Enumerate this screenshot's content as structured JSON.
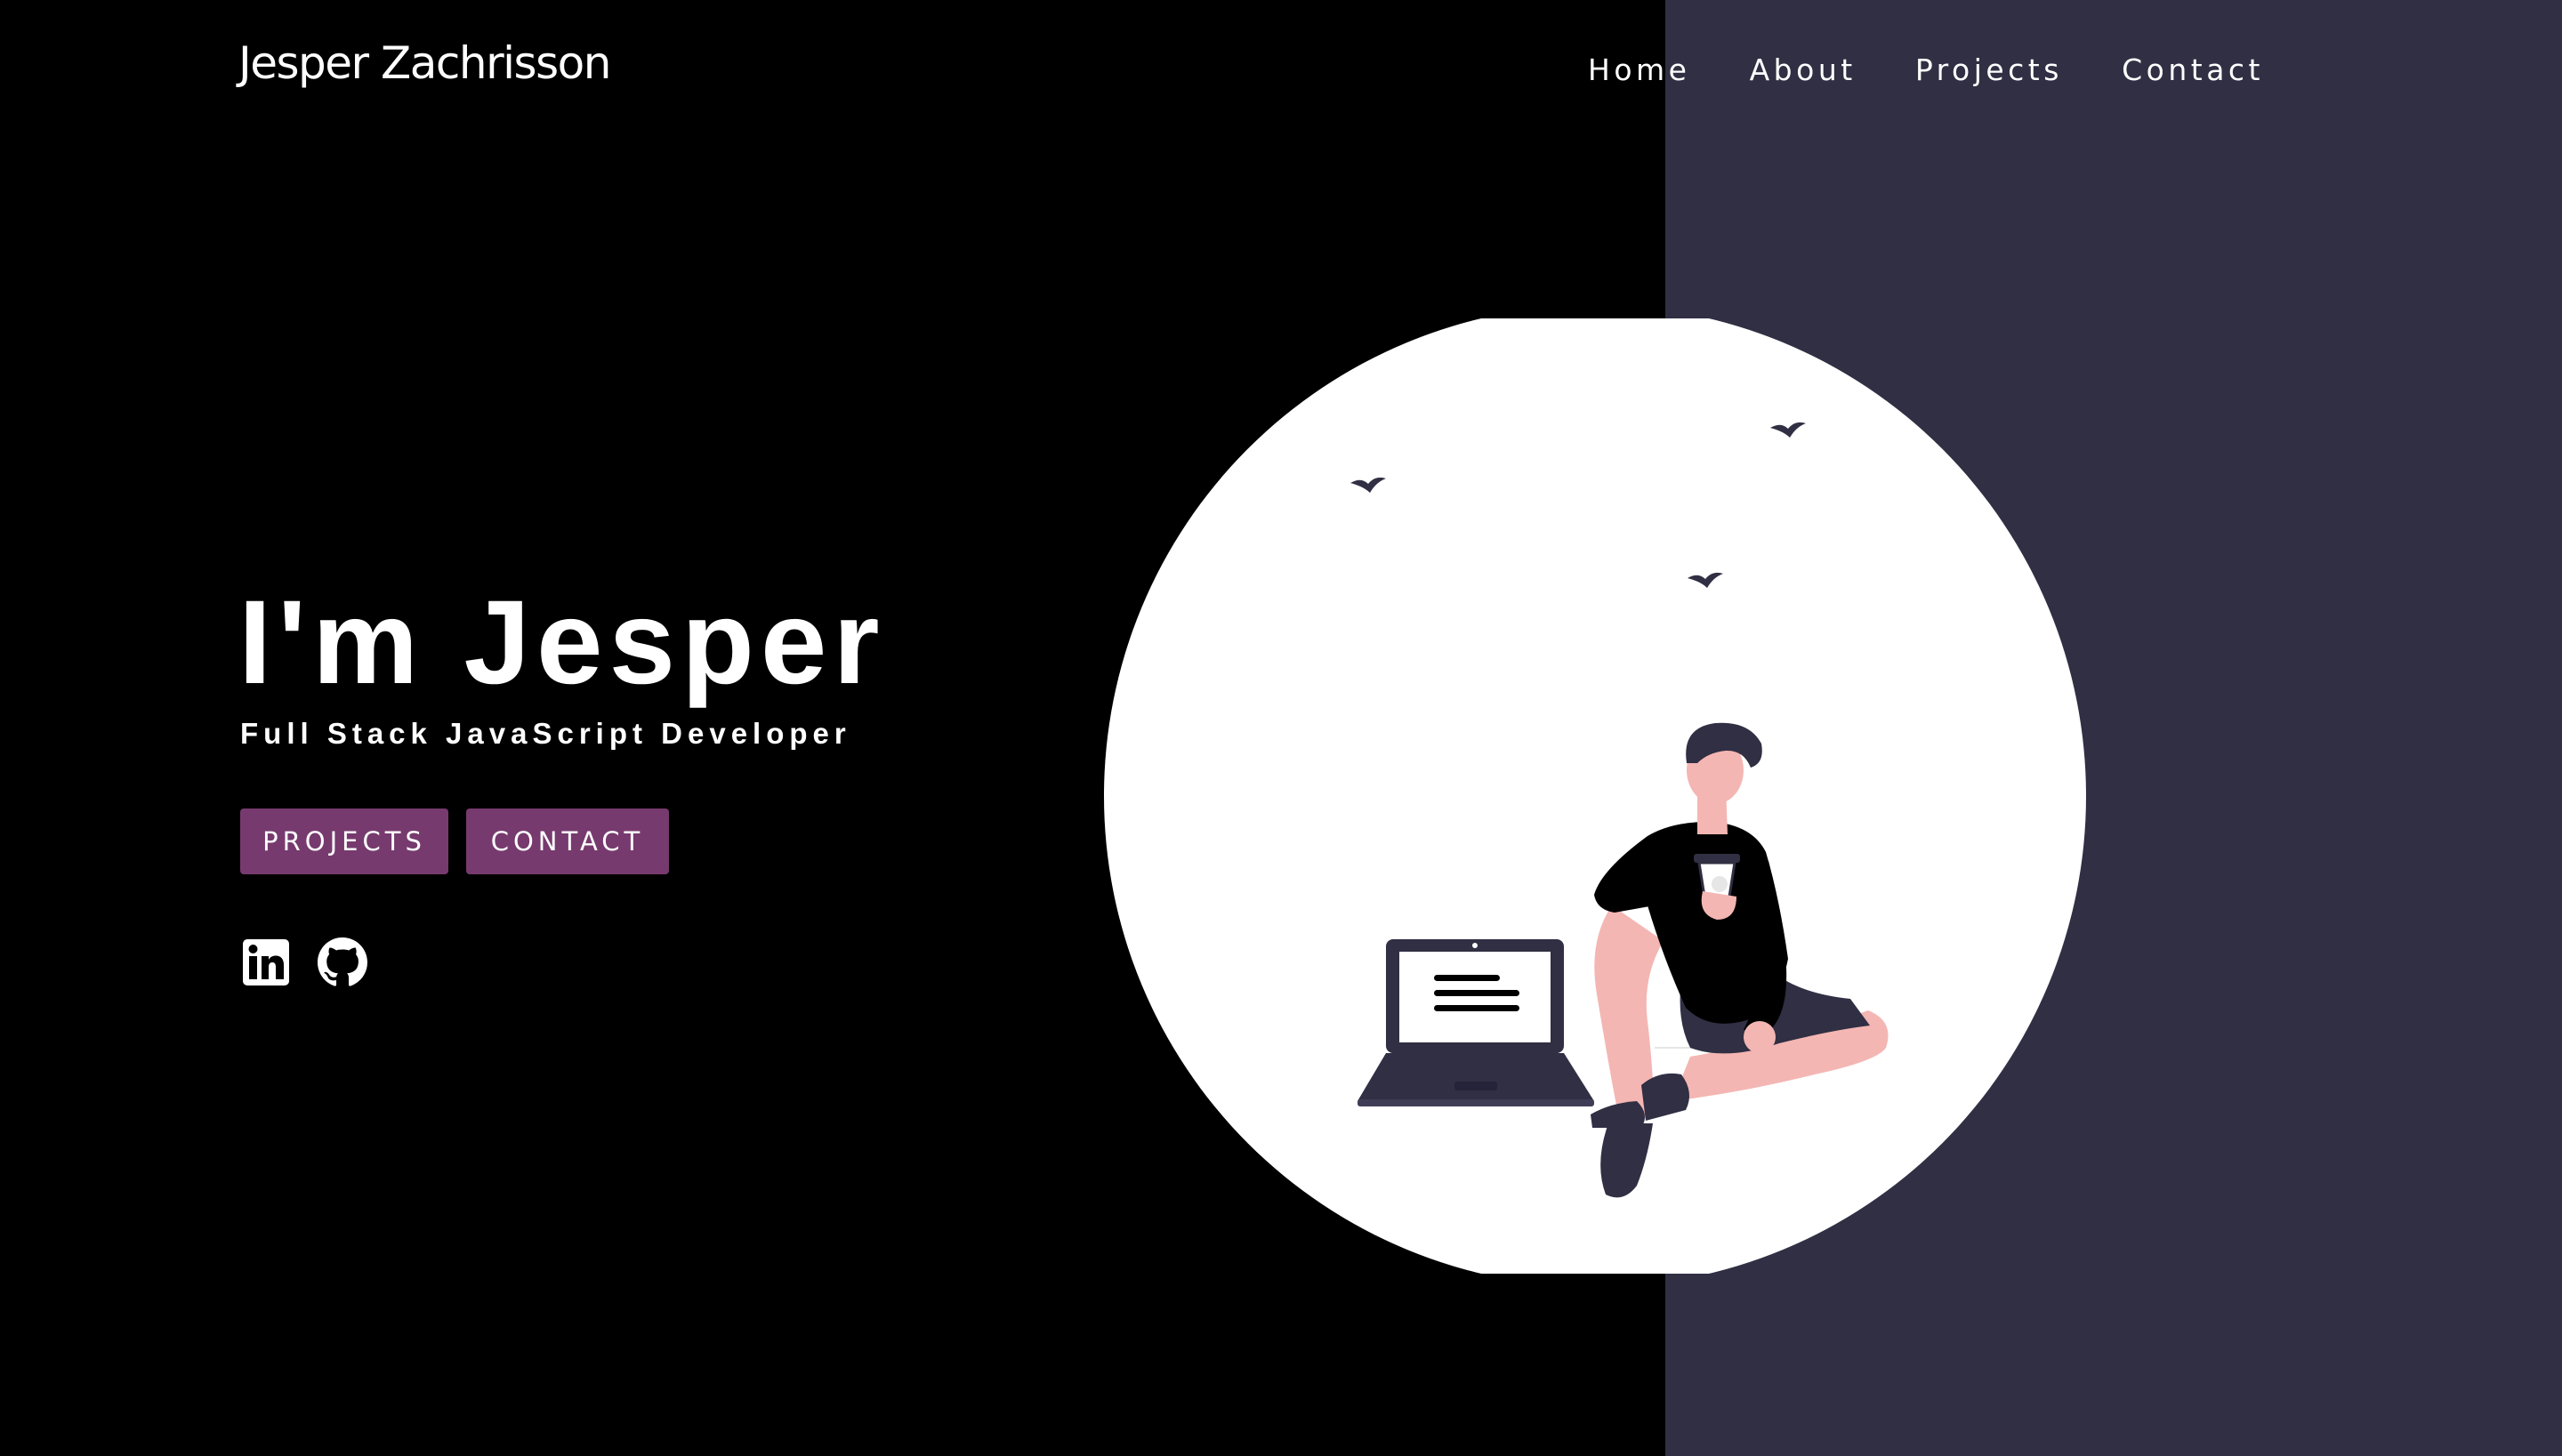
{
  "header": {
    "brand": "Jesper Zachrisson",
    "nav": [
      {
        "label": "Home"
      },
      {
        "label": "About"
      },
      {
        "label": "Projects"
      },
      {
        "label": "Contact"
      }
    ]
  },
  "hero": {
    "title": "I'm Jesper",
    "subtitle": "Full Stack JavaScript Developer",
    "buttons": {
      "projects": "PROJECTS",
      "contact": "CONTACT"
    },
    "social": [
      {
        "icon": "linkedin-icon"
      },
      {
        "icon": "github-icon"
      }
    ]
  },
  "colors": {
    "background_left": "#000000",
    "background_right": "#302f43",
    "button": "#773a6e",
    "text": "#ffffff",
    "skin": "#f4b6b3"
  }
}
